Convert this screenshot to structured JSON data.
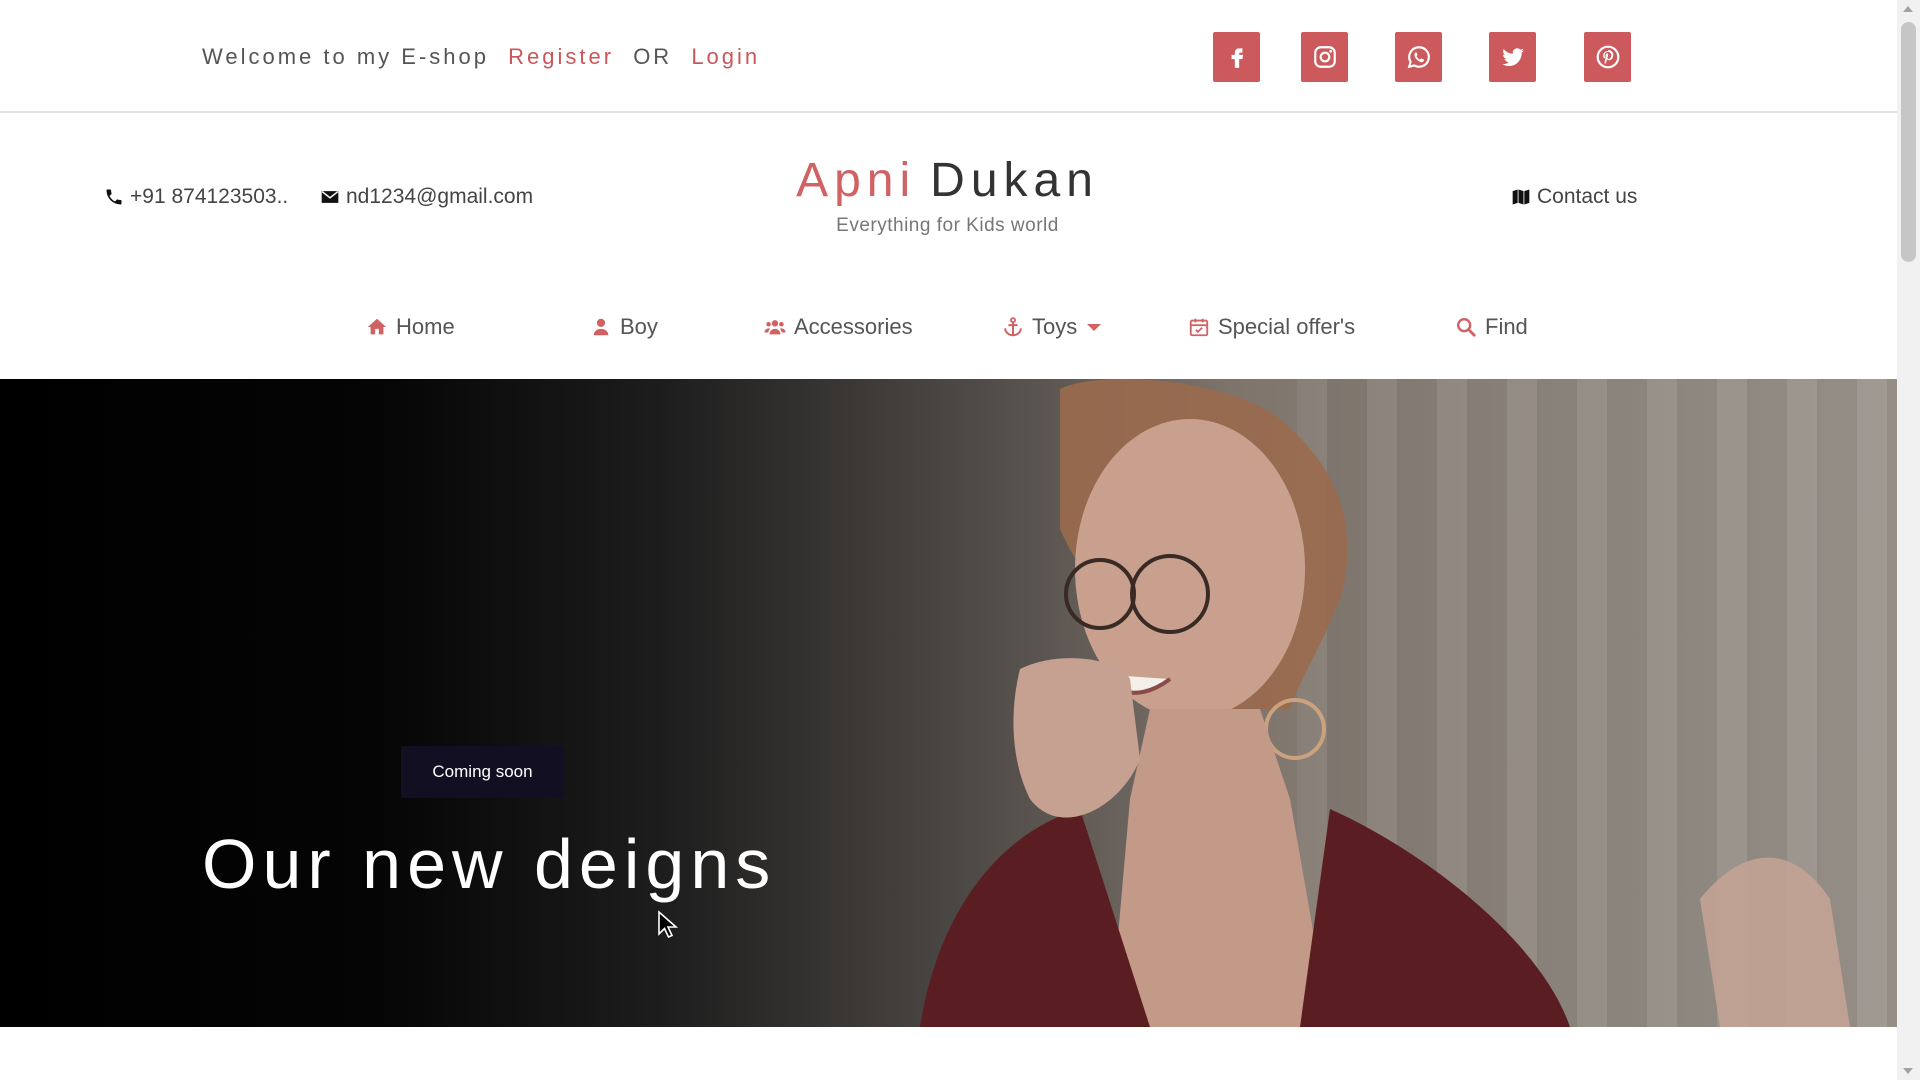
{
  "topbar": {
    "welcome_text": "Welcome to my E-shop",
    "register_label": "Register",
    "or_text": "OR",
    "login_label": "Login",
    "socials": [
      {
        "name": "facebook-icon",
        "glyph": "f"
      },
      {
        "name": "instagram-icon",
        "glyph": "ig"
      },
      {
        "name": "whatsapp-icon",
        "glyph": "wa"
      },
      {
        "name": "twitter-icon",
        "glyph": "tw"
      },
      {
        "name": "pinterest-icon",
        "glyph": "p"
      }
    ]
  },
  "header": {
    "phone": "+91 874123503..",
    "email": "nd1234@gmail.com",
    "brand_part1": "Apni",
    "brand_part2": "Dukan",
    "tagline": "Everything for Kids world",
    "contact_label": "Contact us"
  },
  "nav": {
    "items": [
      {
        "label": "Home",
        "icon": "home-icon"
      },
      {
        "label": "Boy",
        "icon": "user-icon"
      },
      {
        "label": "Accessories",
        "icon": "users-icon"
      },
      {
        "label": "Toys",
        "icon": "anchor-icon"
      },
      {
        "label": "Special offer's",
        "icon": "calendar-icon"
      },
      {
        "label": "Find",
        "icon": "search-icon"
      }
    ]
  },
  "hero": {
    "badge": "Coming soon",
    "title": "Our new deigns"
  },
  "colors": {
    "accent": "#cc5a5c",
    "badge_bg": "#130f22"
  }
}
